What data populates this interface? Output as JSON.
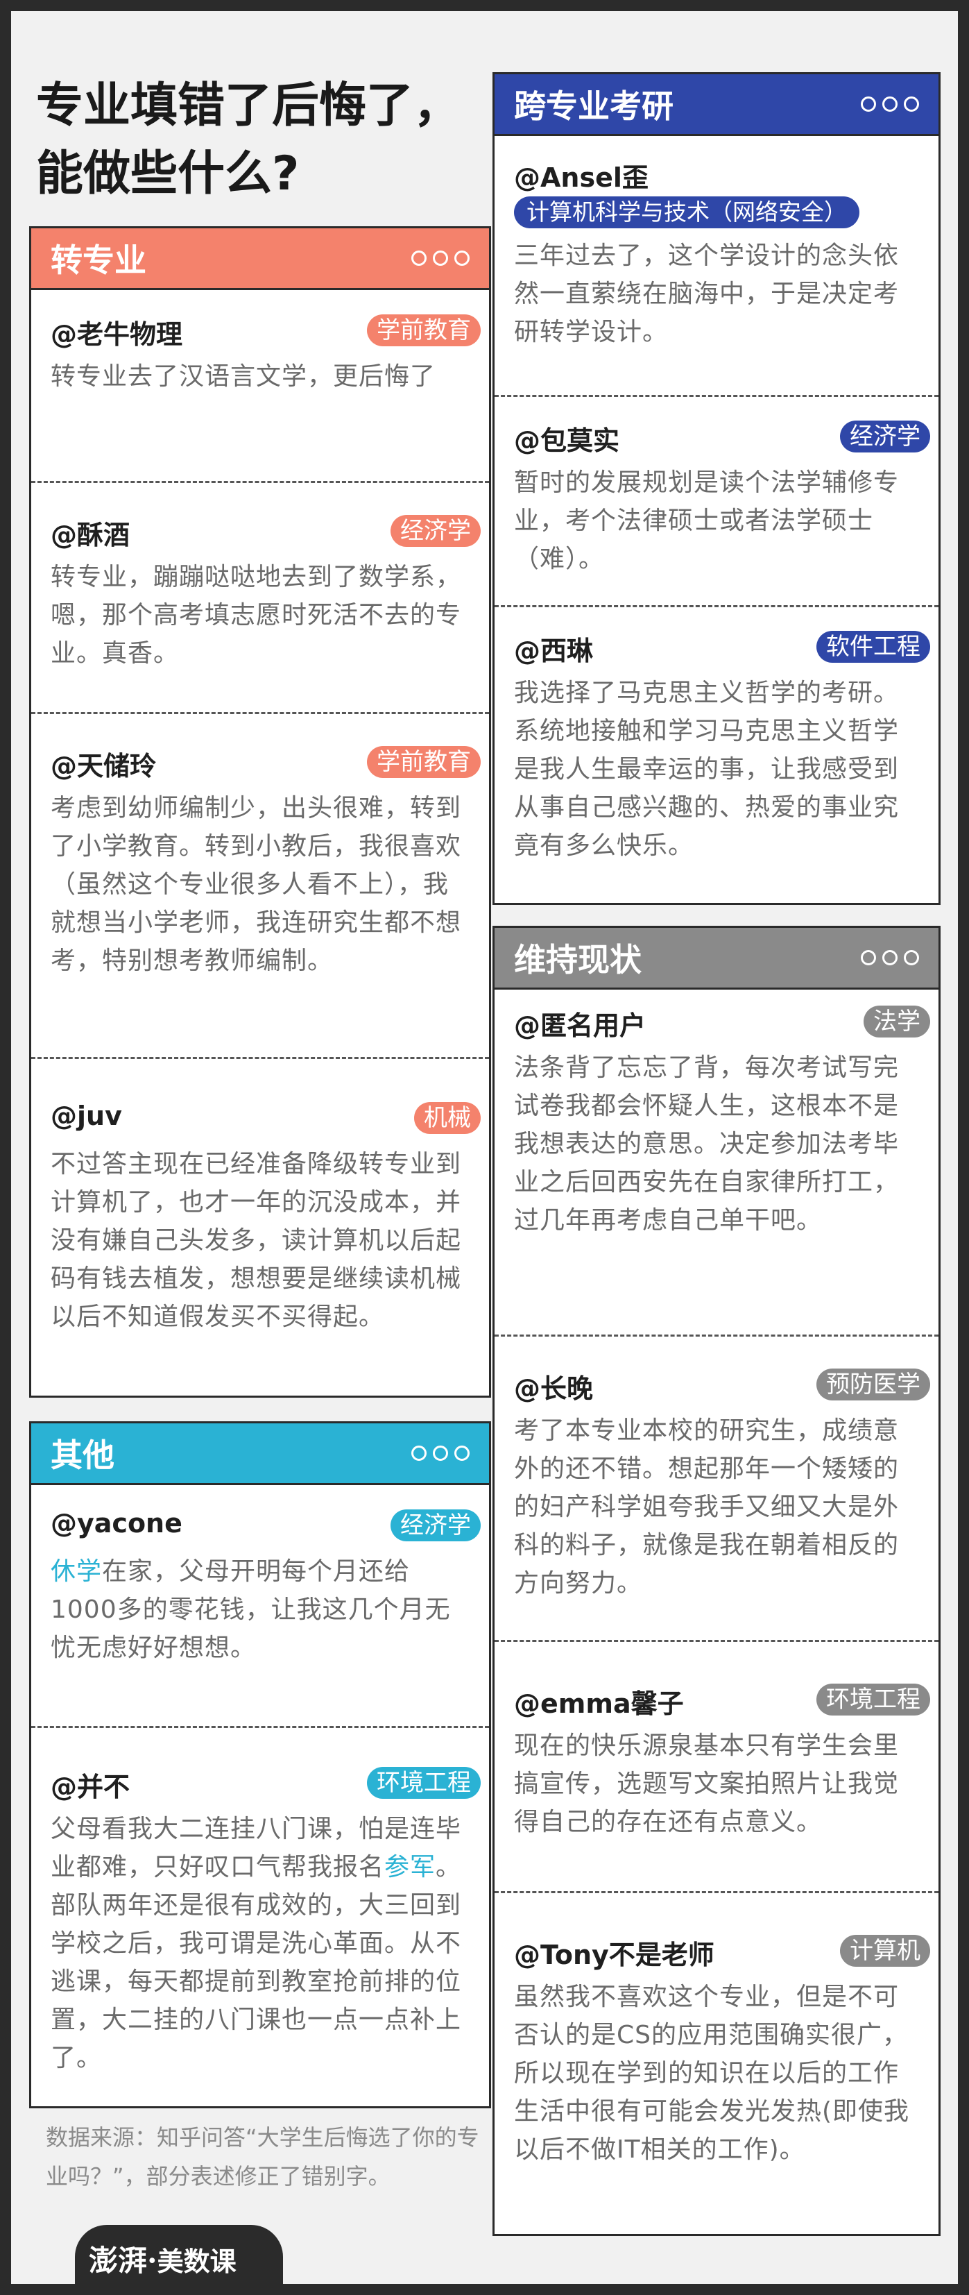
{
  "title": {
    "line1": "专业填错了后悔了，",
    "line2": "能做些什么?"
  },
  "colors": {
    "transfer": "#f4826c",
    "other": "#2ab2d4",
    "grad": "#2f47a8",
    "keep": "#8a8a8a"
  },
  "sections": {
    "transfer": {
      "title": "转专业",
      "entries": [
        {
          "user": "@老牛物理",
          "tag": "学前教育",
          "text": "转专业去了汉语言文学，更后悔了"
        },
        {
          "user": "@酥酒",
          "tag": "经济学",
          "text": "转专业，蹦蹦哒哒地去到了数学系，嗯，那个高考填志愿时死活不去的专业。真香。"
        },
        {
          "user": "@天储玲",
          "tag": "学前教育",
          "text": "考虑到幼师编制少，出头很难，转到了小学教育。转到小教后，我很喜欢（虽然这个专业很多人看不上），我就想当小学老师，我连研究生都不想考，特别想考教师编制。"
        },
        {
          "user": "@juv",
          "tag": "机械",
          "text": "不过答主现在已经准备降级转专业到计算机了，也才一年的沉没成本，并没有嫌自己头发多，读计算机以后起码有钱去植发，想想要是继续读机械以后不知道假发买不买得起。"
        }
      ]
    },
    "other": {
      "title": "其他",
      "entries": [
        {
          "user": "@yacone",
          "tag": "经济学",
          "hl": "休学",
          "text": "在家，父母开明每个月还给1000多的零花钱，让我这几个月无忧无虑好好想想。"
        },
        {
          "user": "@并不",
          "tag": "环境工程",
          "text_before": "父母看我大二连挂八门课，怕是连毕业都难，只好叹口气帮我报名",
          "hl": "参军",
          "text_after": "。部队两年还是很有成效的，大三回到学校之后，我可谓是洗心革面。从不逃课，每天都提前到教室抢前排的位置，大二挂的八门课也一点一点补上了。"
        }
      ]
    },
    "grad": {
      "title": "跨专业考研",
      "entries": [
        {
          "user": "@Ansel歪",
          "major": "计算机科学与技术（网络安全）",
          "text": "三年过去了，这个学设计的念头依然一直萦绕在脑海中，于是决定考研转学设计。"
        },
        {
          "user": "@包莫实",
          "tag": "经济学",
          "text": "暂时的发展规划是读个法学辅修专业，考个法律硕士或者法学硕士（难）。"
        },
        {
          "user": "@西琳",
          "tag": "软件工程",
          "text": "我选择了马克思主义哲学的考研。系统地接触和学习马克思主义哲学是我人生最幸运的事，让我感受到从事自己感兴趣的、热爱的事业究竟有多么快乐。"
        }
      ]
    },
    "keep": {
      "title": "维持现状",
      "entries": [
        {
          "user": "@匿名用户",
          "tag": "法学",
          "text": "法条背了忘忘了背，每次考试写完试卷我都会怀疑人生，这根本不是我想表达的意思。决定参加法考毕业之后回西安先在自家律所打工，过几年再考虑自己单干吧。"
        },
        {
          "user": "@长晚",
          "tag": "预防医学",
          "text": "考了本专业本校的研究生，成绩意外的还不错。想起那年一个矮矮的的妇产科学姐夸我手又细又大是外科的料子，就像是我在朝着相反的方向努力。"
        },
        {
          "user": "@emma馨子",
          "tag": "环境工程",
          "text": "现在的快乐源泉基本只有学生会里搞宣传，选题写文案拍照片让我觉得自己的存在还有点意义。"
        },
        {
          "user": "@Tony不是老师",
          "tag": "计算机",
          "text": "虽然我不喜欢这个专业，但是不可否认的是CS的应用范围确实很广，所以现在学到的知识在以后的工作生活中很有可能会发光发热(即使我以后不做IT相关的工作)。"
        }
      ]
    }
  },
  "source": "数据来源：知乎问答“大学生后悔选了你的专业吗？”，部分表述修正了错别字。",
  "footer": {
    "logo_brand": "澎湃",
    "logo_sep": "·",
    "logo_sub": "美数课"
  }
}
